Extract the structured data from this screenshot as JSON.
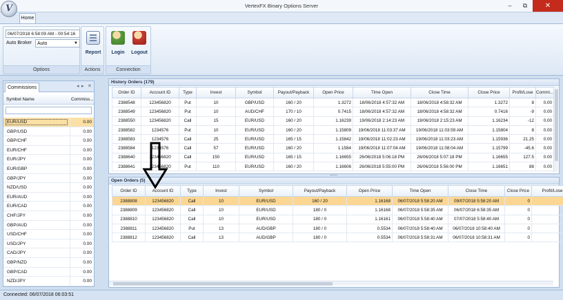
{
  "window": {
    "title": "VertexFX Binary Options Server",
    "minimize": "–",
    "restore": "⧉",
    "close": "✕"
  },
  "logo_letter": "V",
  "tab": "Home",
  "ribbon": {
    "datetime": "06/07/2018 6:58:09 AM  - 00:54:16",
    "broker_label": "Auto Broker",
    "broker_value": "Auto",
    "group_options": "Options",
    "group_actions": "Actions",
    "group_connection": "Connection",
    "report": "Report",
    "login": "Login",
    "logout": "Logout"
  },
  "commissions": {
    "tab": "Commissions",
    "headers": [
      "Symbol Name",
      "Commiss..."
    ],
    "rows": [
      [
        "EUR/USD",
        "0.00"
      ],
      [
        "GBP/USD",
        "0.00"
      ],
      [
        "GBP/CHF",
        "0.00"
      ],
      [
        "EUR/CHF",
        "0.00"
      ],
      [
        "EUR/JPY",
        "0.00"
      ],
      [
        "EUR/GBP",
        "0.00"
      ],
      [
        "GBP/JPY",
        "0.00"
      ],
      [
        "NZD/USD",
        "0.00"
      ],
      [
        "EUR/AUD",
        "0.00"
      ],
      [
        "EUR/CAD",
        "0.00"
      ],
      [
        "CHF/JPY",
        "0.00"
      ],
      [
        "GBP/AUD",
        "0.00"
      ],
      [
        "USD/CHF",
        "0.00"
      ],
      [
        "USD/JPY",
        "0.00"
      ],
      [
        "CAD/JPY",
        "0.00"
      ],
      [
        "GBP/NZD",
        "0.00"
      ],
      [
        "GBP/CAD",
        "0.00"
      ],
      [
        "NZD/JPY",
        "0.00"
      ]
    ]
  },
  "history": {
    "title": "History Orders (179)",
    "headers": [
      "Order ID",
      "Account ID",
      "Type",
      "Invest",
      "Symbol",
      "Payout/Payback",
      "Open Price",
      "Time Open",
      "Close Time",
      "Close Price",
      "Profit/Lose",
      "Commi..."
    ],
    "rows": [
      [
        "2388548",
        "123456820",
        "Put",
        "10",
        "GBP/USD",
        "160 / 20",
        "1.3272",
        "18/06/2018 4:57:32 AM",
        "18/06/2018 4:58:32 AM",
        "1.3272",
        "8",
        "0.00"
      ],
      [
        "2388549",
        "123456820",
        "Put",
        "10",
        "AUD/CHF",
        "170 / 10",
        "0.7415",
        "18/06/2018 4:57:32 AM",
        "18/06/2018 4:58:32 AM",
        "0.7416",
        "-9",
        "0.00"
      ],
      [
        "2388550",
        "123456820",
        "Call",
        "15",
        "EUR/USD",
        "160 / 20",
        "1.16239",
        "19/06/2018 2:14:23 AM",
        "19/06/2018 2:15:23 AM",
        "1.16234",
        "-12",
        "0.00"
      ],
      [
        "2388582",
        "1234576",
        "Put",
        "10",
        "EUR/USD",
        "160 / 20",
        "1.15809",
        "19/06/2018 11:03:37 AM",
        "19/06/2018 11:03:59 AM",
        "1.15804",
        "8",
        "0.00"
      ],
      [
        "2388583",
        "1234576",
        "Call",
        "25",
        "EUR/USD",
        "165 / 15",
        "1.15842",
        "19/06/2018 11:02:23 AM",
        "19/06/2018 11:03:23 AM",
        "1.15936",
        "21.25",
        "0.00"
      ],
      [
        "2388584",
        "1234576",
        "Call",
        "57",
        "EUR/USD",
        "160 / 20",
        "1.1584",
        "19/06/2018 11:07:04 AM",
        "19/06/2018 11:08:04 AM",
        "1.15799",
        "-45.6",
        "0.00"
      ],
      [
        "2388640",
        "123456820",
        "Call",
        "150",
        "EUR/USD",
        "165 / 15",
        "1.16655",
        "26/06/2018 5:06:18 PM",
        "26/06/2018 5:07:18 PM",
        "1.16655",
        "127.5",
        "0.00"
      ],
      [
        "2388641",
        "123456820",
        "Put",
        "110",
        "EUR/USD",
        "160 / 20",
        "1.16606",
        "26/06/2018 5:55:00 PM",
        "26/06/2018 5:56:00 PM",
        "1.16651",
        "88",
        "0.00"
      ]
    ]
  },
  "open": {
    "title": "Open Orders (5)",
    "headers": [
      "Order ID",
      "Account ID",
      "Type",
      "Invest",
      "Symbol",
      "Payout/Payback",
      "Open Price",
      "Time Open",
      "Close Time",
      "Close Price",
      "Profit/Lose"
    ],
    "rows": [
      [
        "2388808",
        "123456820",
        "Call",
        "10",
        "EUR/USD",
        "160 / 20",
        "1.16168",
        "06/07/2018 5:58:20 AM",
        "09/07/2018 5:58:20 AM",
        "0",
        ""
      ],
      [
        "2388809",
        "123456820",
        "Call",
        "10",
        "EUR/USD",
        "180 / 0",
        "1.16168",
        "06/07/2018 5:58:35 AM",
        "06/07/2018 6:58:35 AM",
        "0",
        ""
      ],
      [
        "2388810",
        "123456820",
        "Call",
        "10",
        "EUR/USD",
        "180 / 0",
        "1.16161",
        "06/07/2018 5:58:40 AM",
        "07/07/2018 5:58:40 AM",
        "0",
        ""
      ],
      [
        "2388811",
        "123456820",
        "Put",
        "13",
        "AUD/GBP",
        "180 / 0",
        "0.5534",
        "06/07/2018 5:58:40 AM",
        "06/07/2018 10:58:40 AM",
        "0",
        ""
      ],
      [
        "2388812",
        "123456820",
        "Call",
        "13",
        "AUD/GBP",
        "180 / 0",
        "0.5534",
        "06/07/2018 5:58:31 AM",
        "06/07/2018 10:58:31 AM",
        "0",
        ""
      ]
    ]
  },
  "status": "Connected: 06/07/2018 06:03:51"
}
